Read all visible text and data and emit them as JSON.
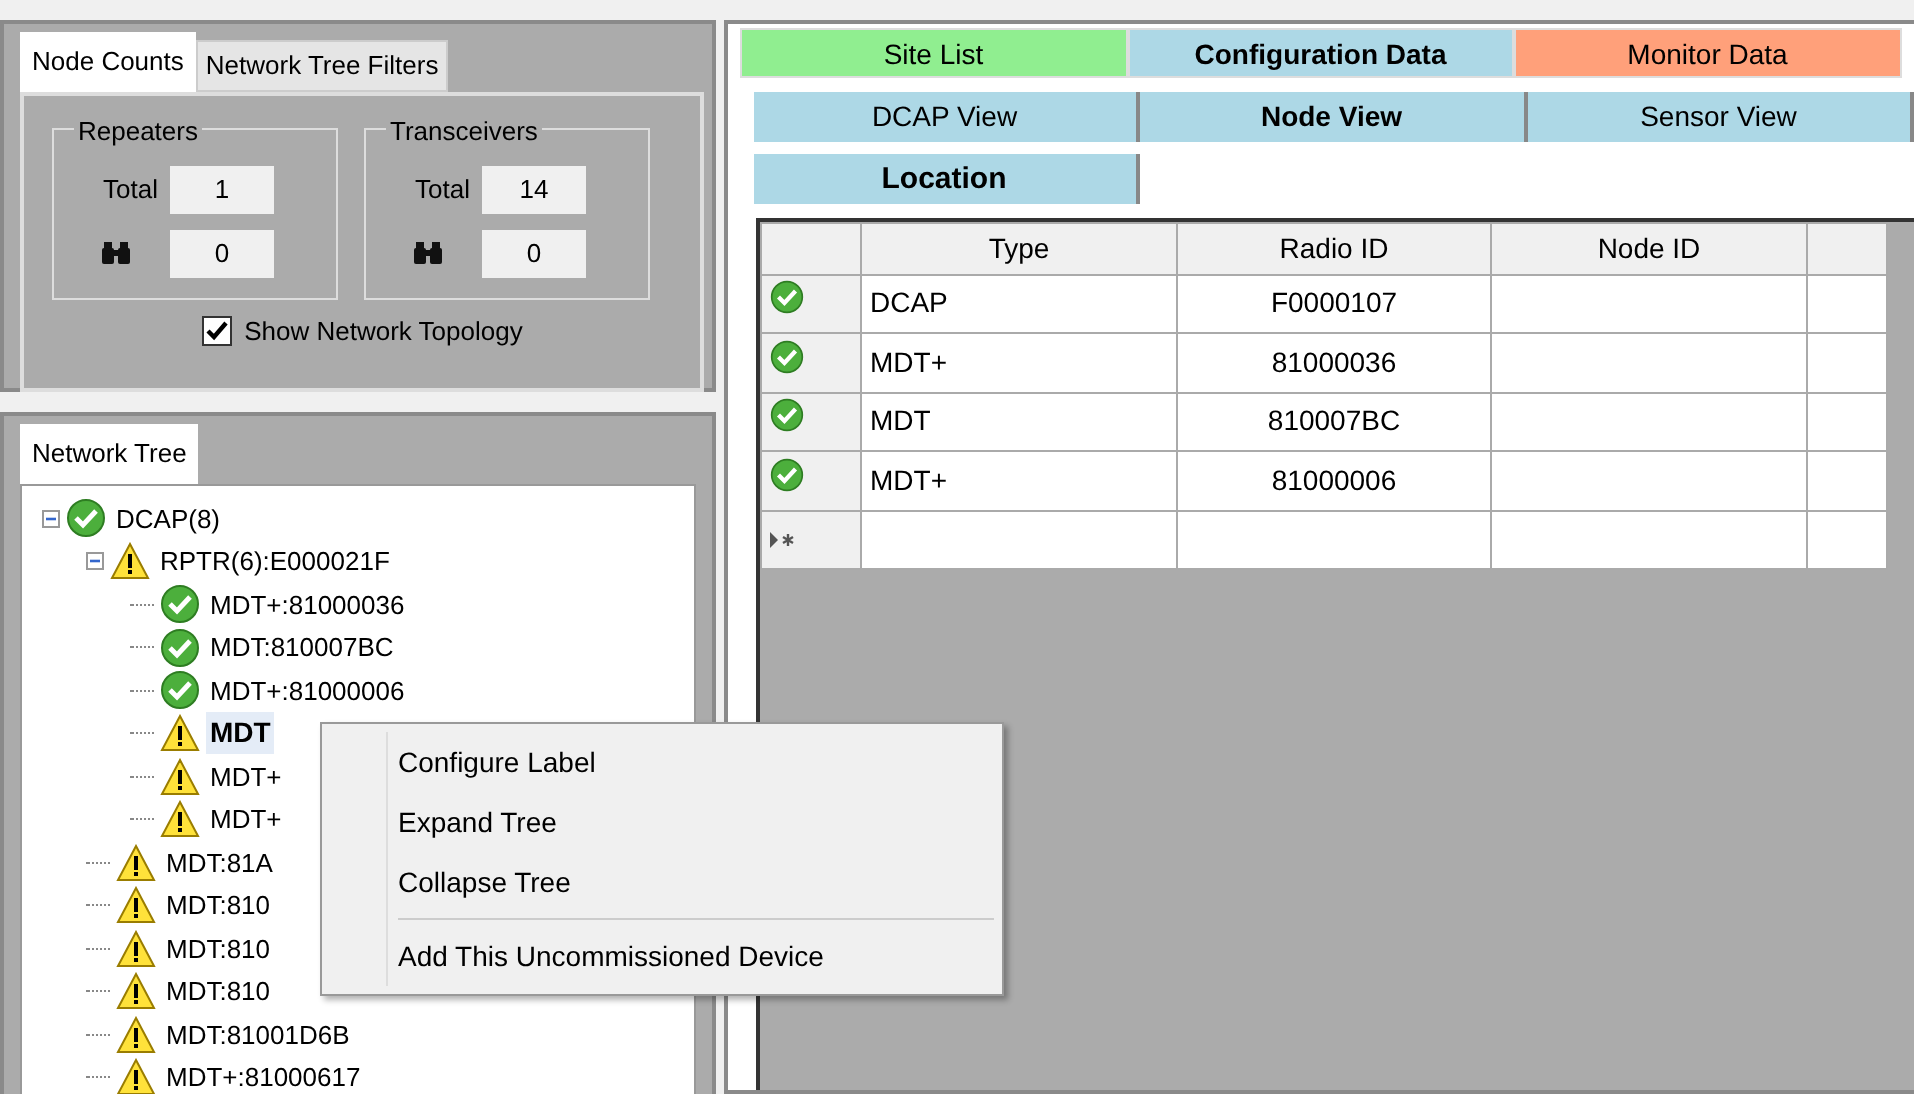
{
  "left_tabs": [
    {
      "label": "Node Counts",
      "selected": true
    },
    {
      "label": "Network Tree Filters",
      "selected": false
    }
  ],
  "counts": [
    {
      "title": "Repeaters",
      "total_label": "Total",
      "total": "1",
      "found": "0"
    },
    {
      "title": "Transceivers",
      "total_label": "Total",
      "total": "14",
      "found": "0"
    }
  ],
  "show_topology": {
    "label": "Show Network Topology",
    "checked": true
  },
  "tree_tab": {
    "label": "Network Tree",
    "selected": true
  },
  "tree": [
    {
      "label": "DCAP(8)",
      "kind": "ok",
      "expanded": true,
      "selected": false,
      "children": [
        {
          "label": "RPTR(6):E000021F",
          "kind": "warn",
          "expanded": true,
          "selected": false,
          "children": [
            {
              "label": "MDT+:81000036",
              "kind": "ok",
              "selected": false
            },
            {
              "label": "MDT:810007BC",
              "kind": "ok",
              "selected": false
            },
            {
              "label": "MDT+:81000006",
              "kind": "ok",
              "selected": false
            },
            {
              "label": "MDT",
              "kind": "warn",
              "selected": true
            },
            {
              "label": "MDT+",
              "kind": "warn",
              "selected": false
            },
            {
              "label": "MDT+",
              "kind": "warn",
              "selected": false
            }
          ]
        },
        {
          "label": "MDT:81A",
          "kind": "warn",
          "selected": false
        },
        {
          "label": "MDT:810",
          "kind": "warn",
          "selected": false
        },
        {
          "label": "MDT:810",
          "kind": "warn",
          "selected": false
        },
        {
          "label": "MDT:810",
          "kind": "warn",
          "selected": false
        },
        {
          "label": "MDT:81001D6B",
          "kind": "warn",
          "selected": false
        },
        {
          "label": "MDT+:81000617",
          "kind": "warn",
          "selected": false
        }
      ]
    }
  ],
  "main_tabs": [
    {
      "label": "Site List",
      "selected": false,
      "color": "#90ee90"
    },
    {
      "label": "Configuration Data",
      "selected": true,
      "color": "#add8e6"
    },
    {
      "label": "Monitor Data",
      "selected": false,
      "color": "#ffa07a"
    }
  ],
  "sub_tabs": [
    {
      "label": "DCAP View",
      "selected": false
    },
    {
      "label": "Node View",
      "selected": true
    },
    {
      "label": "Sensor View",
      "selected": false
    }
  ],
  "inner_tabs": [
    {
      "label": "Location",
      "selected": true
    }
  ],
  "table": {
    "columns": [
      "Type",
      "Radio ID",
      "Node ID"
    ],
    "rows": [
      {
        "kind": "ok",
        "type": "DCAP",
        "radio_id": "F0000107"
      },
      {
        "kind": "ok",
        "type": "MDT+",
        "radio_id": "81000036"
      },
      {
        "kind": "ok",
        "type": "MDT",
        "radio_id": "810007BC"
      },
      {
        "kind": "ok",
        "type": "MDT+",
        "radio_id": "81000006"
      }
    ]
  },
  "context_menu": [
    {
      "label": "Configure Label",
      "kind": "item"
    },
    {
      "label": "Expand Tree",
      "kind": "item"
    },
    {
      "label": "Collapse Tree",
      "kind": "item"
    },
    {
      "kind": "separator"
    },
    {
      "label": "Add This Uncommissioned Device",
      "kind": "item"
    }
  ]
}
